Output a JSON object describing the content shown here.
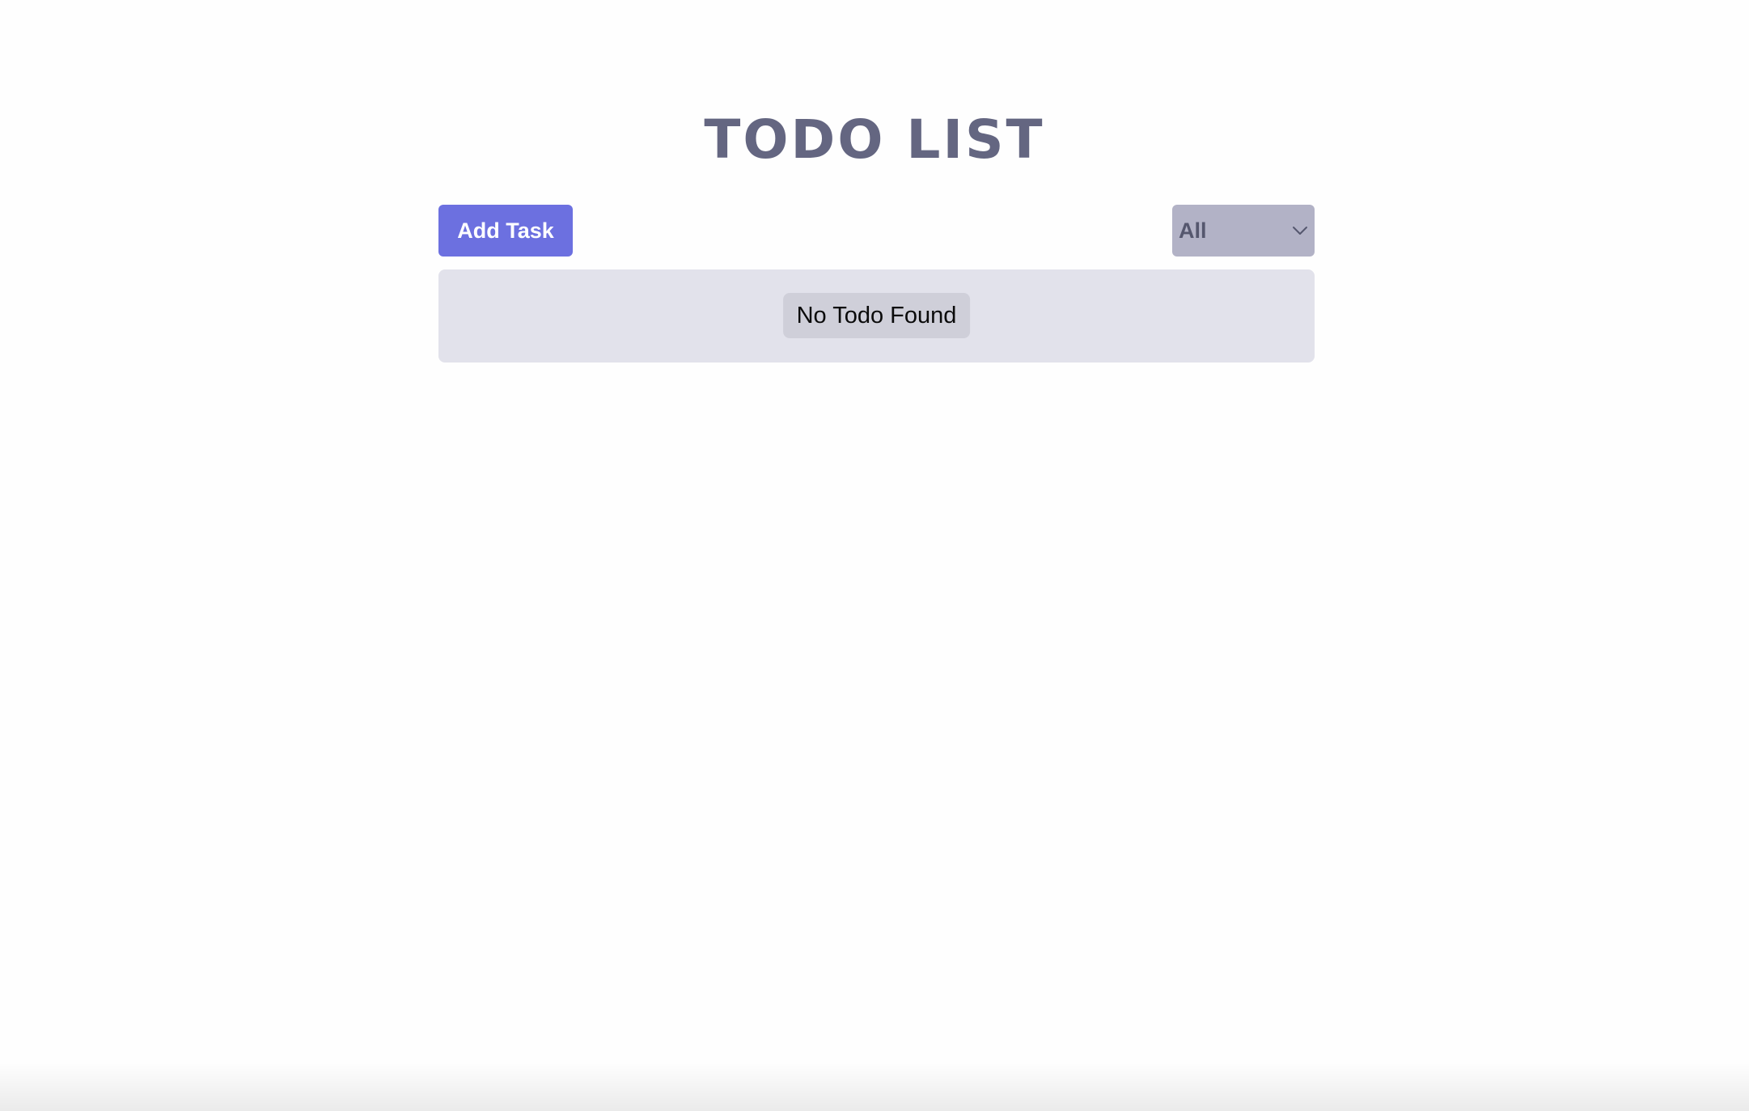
{
  "header": {
    "title": "TODO LIST"
  },
  "toolbar": {
    "add_label": "Add Task",
    "filter_value": "All",
    "filter_icon": "chevron-down-icon"
  },
  "list": {
    "empty_message": "No Todo Found"
  },
  "colors": {
    "accent": "#6c70e0",
    "title": "#646681",
    "filter_bg": "#b2b2c6",
    "list_bg": "#e2e2eb"
  }
}
